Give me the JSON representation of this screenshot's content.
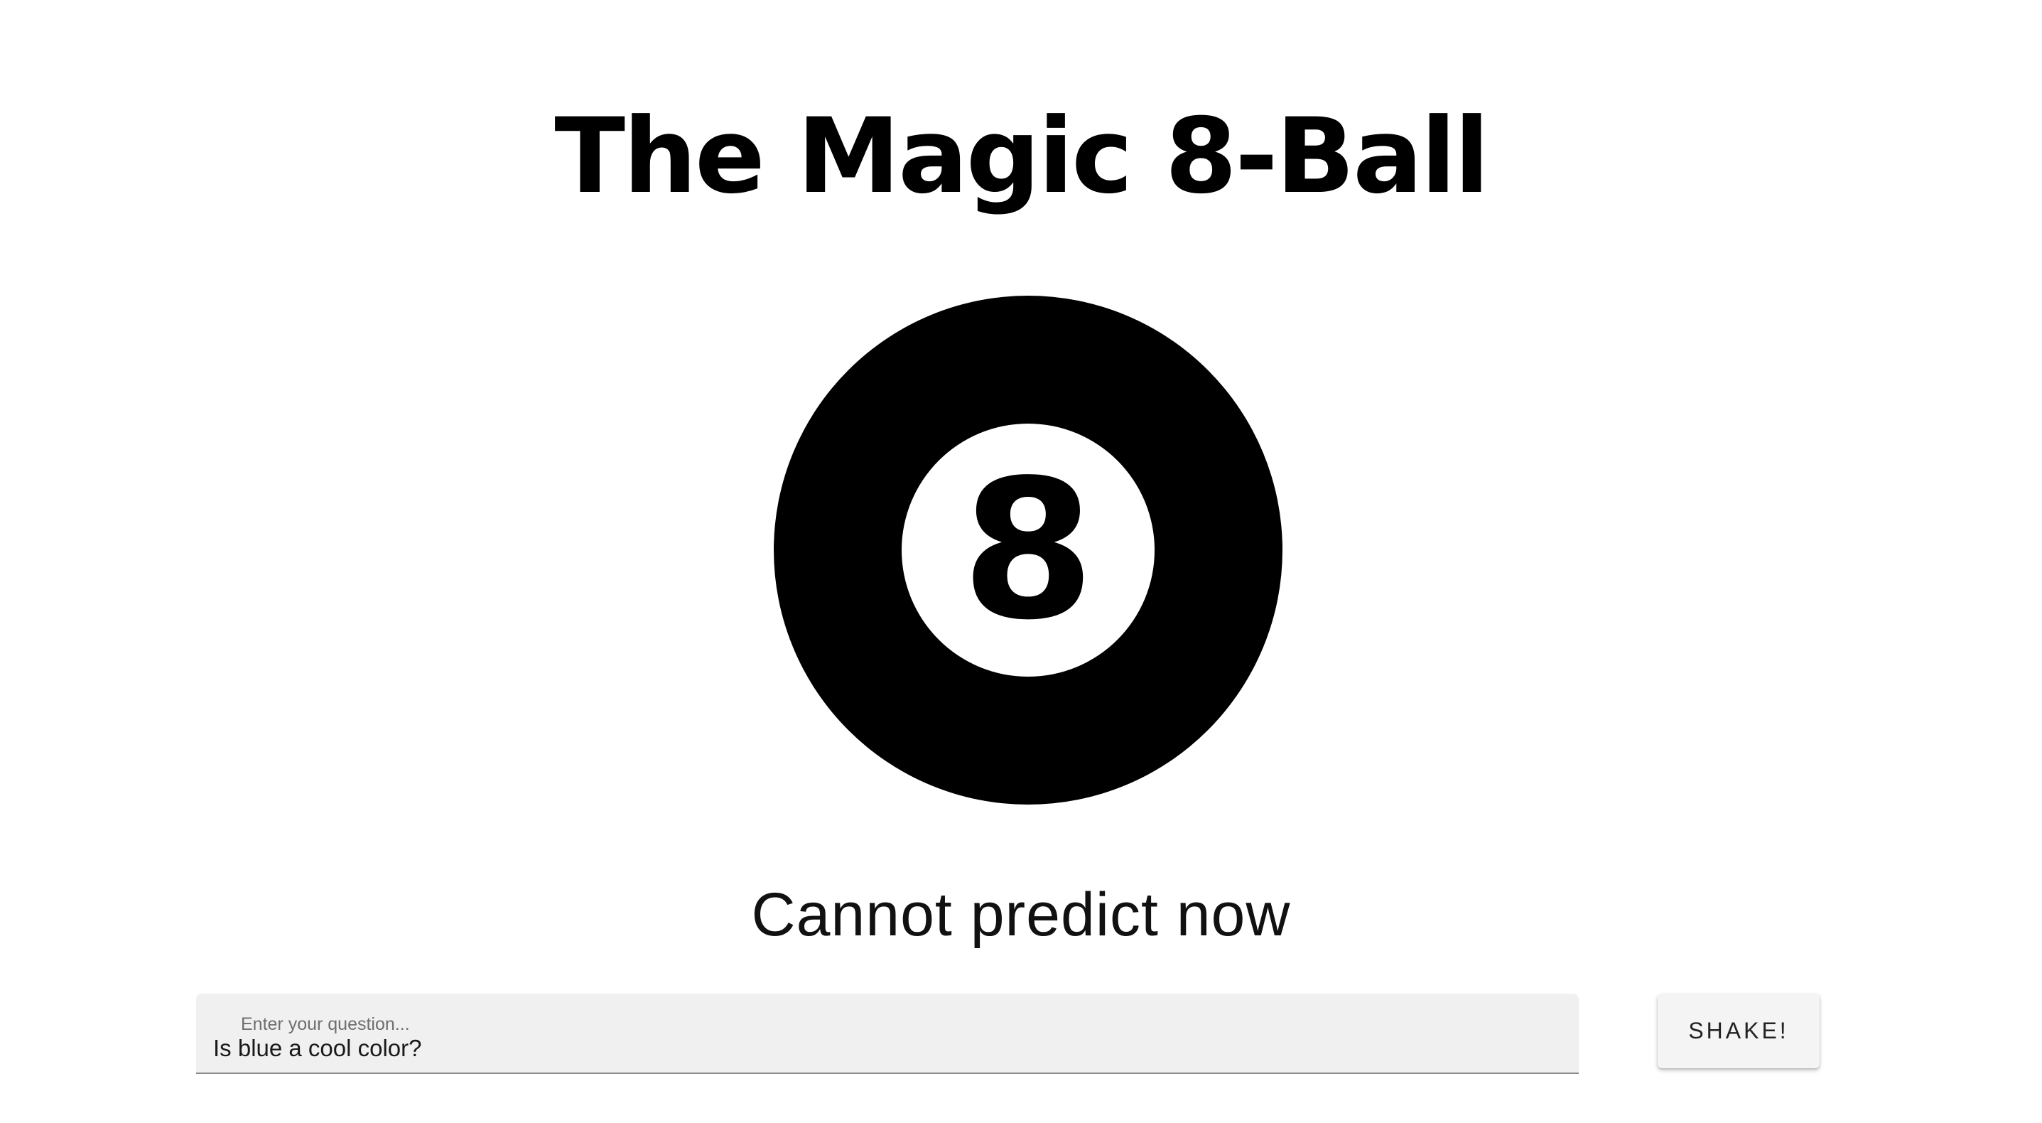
{
  "header": {
    "title": "The Magic 8-Ball"
  },
  "ball": {
    "number": "8",
    "icon": "magic-8-ball-icon",
    "colors": {
      "outer": "#000000",
      "inner": "#ffffff"
    }
  },
  "answer": {
    "text": "Cannot predict now"
  },
  "question": {
    "placeholder": "Enter your question...",
    "value": "Is blue a cool color?"
  },
  "actions": {
    "shake_label": "SHAKE!"
  }
}
